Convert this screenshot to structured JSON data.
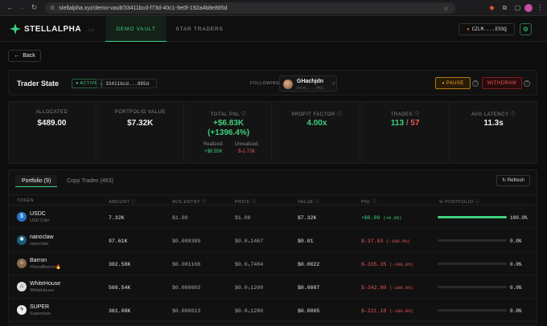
{
  "browser": {
    "url": "stellalpha.xyz/demo-vault/33411bcd-f73d-40c1-9e0f-192a4b8e885d"
  },
  "nav": {
    "brand": "STELLALPHA",
    "brand_tld": ".xyz",
    "tabs": [
      {
        "label": "DEMO VAULT",
        "active": true
      },
      {
        "label": "STAR TRADERS",
        "active": false
      }
    ],
    "wallet": "CZLM....ESSQ",
    "accent": "#3ed17f"
  },
  "back_label": "Back",
  "trader_state": {
    "title": "Trader State",
    "status": "ACTIVE",
    "vault_id": "33411bcd...885d",
    "following_label": "FOLLOWING:",
    "followed_name": "GHachjdn",
    "followed_sub": "8xvt....PKS",
    "pause_label": "PAUSE",
    "withdraw_label": "WITHDRAW"
  },
  "stats": {
    "allocated": {
      "label": "ALLOCATED",
      "value": "$489.00"
    },
    "portfolio_value": {
      "label": "PORTFOLIO VALUE",
      "value": "$7.32K"
    },
    "total_pnl": {
      "label": "TOTAL PNL",
      "value": "+$6.83K",
      "pct": "(+1396.4%)",
      "realized_label": "Realized:",
      "realized": "+$8.55K",
      "unrealized_label": "Unrealized:",
      "unrealized": "$-1.72K"
    },
    "profit_factor": {
      "label": "PROFIT FACTOR",
      "value": "4.00x"
    },
    "trades": {
      "label": "TRADES",
      "wins": "113",
      "sep": "/",
      "losses": "57"
    },
    "avg_latency": {
      "label": "AVG LATENCY",
      "value": "11.3s"
    }
  },
  "portfolio": {
    "tabs": [
      "Portfolio (9)",
      "Copy Trades (463)"
    ],
    "refresh_label": "Refresh",
    "columns": [
      "TOKEN",
      "AMOUNT",
      "AVG ENTRY",
      "PRICE",
      "VALUE",
      "PNL",
      "% PORTFOLIO"
    ],
    "rows": [
      {
        "symbol": "USDC",
        "name": "USD Coin",
        "amount": "7.32K",
        "avg_entry": "$1.00",
        "price": "$1.00",
        "value": "$7.32K",
        "pnl": "+$0.00",
        "pnl_pct": "(+0.0%)",
        "pnl_positive": true,
        "portfolio_pct": "100.0%",
        "portfolio_fraction": 1.0,
        "icon": "usdc-icon",
        "icon_color": "#2775ca"
      },
      {
        "symbol": "nanoclaw",
        "name": "nanoclaw",
        "amount": "97.61K",
        "avg_entry": "$0.000389",
        "price": "$0.0₄1467",
        "value": "$0.01",
        "pnl": "$-37.93",
        "pnl_pct": "(-100.0%)",
        "pnl_positive": false,
        "portfolio_pct": "0.0%",
        "portfolio_fraction": 0.0,
        "icon": "claw-icon",
        "icon_color": "#1a5a7a"
      },
      {
        "symbol": "Barron",
        "name": "#SendBarron🔥",
        "amount": "302.58K",
        "avg_entry": "$0.001108",
        "price": "$0.0₅7404",
        "value": "$0.0022",
        "pnl": "$-335.35",
        "pnl_pct": "(-100.0%)",
        "pnl_positive": false,
        "portfolio_pct": "0.0%",
        "portfolio_fraction": 0.0,
        "icon": "person-icon",
        "icon_color": "#8a6a4a"
      },
      {
        "symbol": "WhiteHouse",
        "name": "WhiteHouse",
        "amount": "568.54K",
        "avg_entry": "$0.000603",
        "price": "$0.0₅1200",
        "value": "$0.0007",
        "pnl": "$-342.80",
        "pnl_pct": "(-100.0%)",
        "pnl_positive": false,
        "portfolio_pct": "0.0%",
        "portfolio_fraction": 0.0,
        "icon": "building-icon",
        "icon_color": "#dddddd"
      },
      {
        "symbol": "SUPER",
        "name": "Superclaw",
        "amount": "361.08K",
        "avg_entry": "$0.000613",
        "price": "$0.0₅1280",
        "value": "$0.0005",
        "pnl": "$-221.18",
        "pnl_pct": "(-100.0%)",
        "pnl_positive": false,
        "portfolio_pct": "0.0%",
        "portfolio_fraction": 0.0,
        "icon": "lightning-icon",
        "icon_color": "#eeeeee"
      }
    ]
  }
}
